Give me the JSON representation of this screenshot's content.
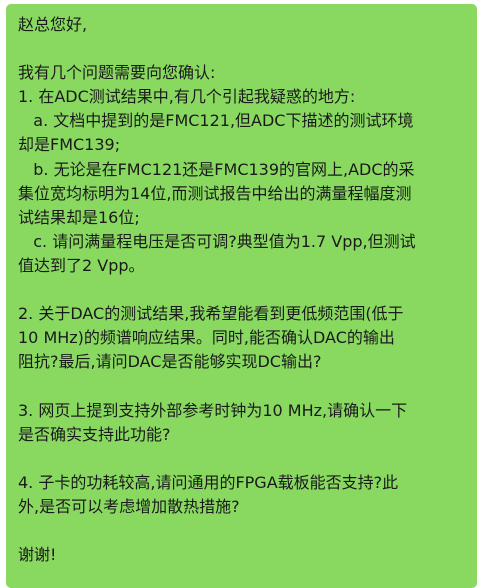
{
  "colors": {
    "bubble_background": "#89d961",
    "text": "#1a1a1a"
  },
  "message": {
    "lines": [
      "赵总您好,",
      "",
      "我有几个问题需要向您确认:",
      "1. 在ADC测试结果中,有几个引起我疑惑的地方:",
      "   a. 文档中提到的是FMC121,但ADC下描述的测试环境",
      "却是FMC139;",
      "   b. 无论是在FMC121还是FMC139的官网上,ADC的采",
      "集位宽均标明为14位,而测试报告中给出的满量程幅度测",
      "试结果却是16位;",
      "   c. 请问满量程电压是否可调?典型值为1.7 Vpp,但测试",
      "值达到了2 Vpp。",
      "",
      "2. 关于DAC的测试结果,我希望能看到更低频范围(低于",
      "10 MHz)的频谱响应结果。同时,能否确认DAC的输出",
      "阻抗?最后,请问DAC是否能够实现DC输出?",
      "",
      "3. 网页上提到支持外部参考时钟为10 MHz,请确认一下",
      "是否确实支持此功能?",
      "",
      "4. 子卡的功耗较高,请问通用的FPGA载板能否支持?此",
      "外,是否可以考虑增加散热措施?",
      "",
      "谢谢!"
    ]
  }
}
